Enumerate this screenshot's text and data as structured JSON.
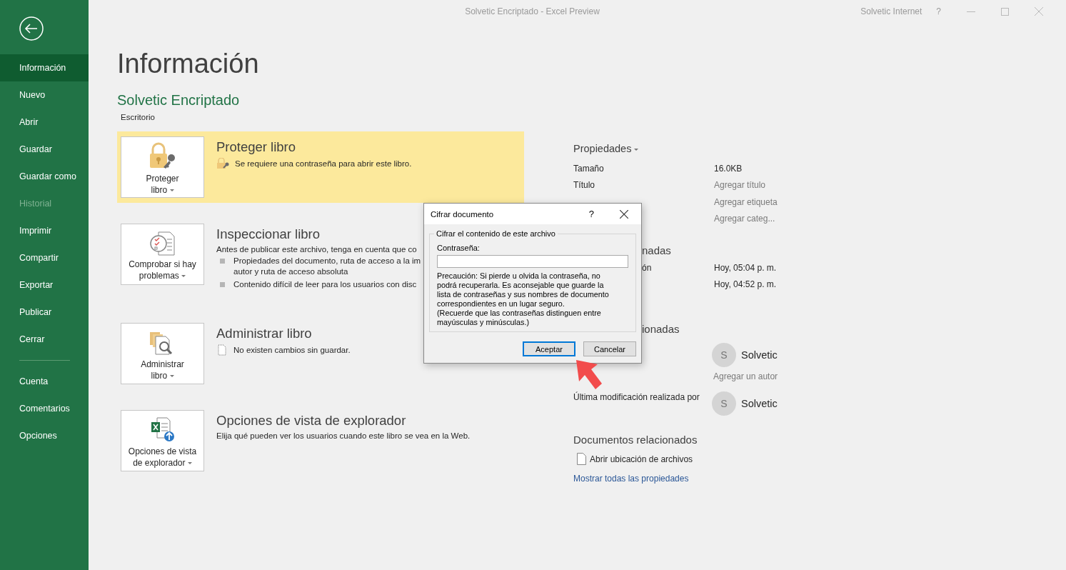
{
  "window": {
    "title": "Solvetic Encriptado  -  Excel Preview",
    "account": "Solvetic Internet",
    "help": "?"
  },
  "sidebar": {
    "items": [
      {
        "label": "Información",
        "selected": true,
        "disabled": false
      },
      {
        "label": "Nuevo",
        "selected": false,
        "disabled": false
      },
      {
        "label": "Abrir",
        "selected": false,
        "disabled": false
      },
      {
        "label": "Guardar",
        "selected": false,
        "disabled": false
      },
      {
        "label": "Guardar como",
        "selected": false,
        "disabled": false
      },
      {
        "label": "Historial",
        "selected": false,
        "disabled": true
      },
      {
        "label": "Imprimir",
        "selected": false,
        "disabled": false
      },
      {
        "label": "Compartir",
        "selected": false,
        "disabled": false
      },
      {
        "label": "Exportar",
        "selected": false,
        "disabled": false
      },
      {
        "label": "Publicar",
        "selected": false,
        "disabled": false
      },
      {
        "label": "Cerrar",
        "selected": false,
        "disabled": false
      }
    ],
    "bottom_items": [
      {
        "label": "Cuenta",
        "selected": false,
        "disabled": false
      },
      {
        "label": "Comentarios",
        "selected": false,
        "disabled": false
      },
      {
        "label": "Opciones",
        "selected": false,
        "disabled": false
      }
    ]
  },
  "page": {
    "title": "Información",
    "file_name": "Solvetic Encriptado",
    "location": "Escritorio"
  },
  "sections": [
    {
      "kind": "protect",
      "button": [
        "Proteger",
        "libro"
      ],
      "title": "Proteger libro",
      "highlighted": true,
      "status": {
        "kind": "lock",
        "text": "Se requiere una contraseña para abrir este libro."
      }
    },
    {
      "kind": "inspect",
      "button": [
        "Comprobar si hay",
        "problemas"
      ],
      "title": "Inspeccionar libro",
      "highlighted": false,
      "text": "Antes de publicar este archivo, tenga en cuenta que co",
      "bullets": [
        [
          "Propiedades del documento, ruta de acceso a la im",
          "autor y ruta de acceso absoluta"
        ],
        [
          "Contenido difícil de leer para los usuarios con disc"
        ]
      ]
    },
    {
      "kind": "manage",
      "button": [
        "Administrar",
        "libro"
      ],
      "title": "Administrar libro",
      "highlighted": false,
      "status": {
        "kind": "doc",
        "text": "No existen cambios sin guardar."
      }
    },
    {
      "kind": "browser",
      "button": [
        "Opciones de vista",
        "de explorador"
      ],
      "title": "Opciones de vista de explorador",
      "highlighted": false,
      "text": "Elija qué pueden ver los usuarios cuando este libro se vea en la Web."
    }
  ],
  "properties": {
    "title": "Propiedades",
    "rows": [
      {
        "label": "Tamaño",
        "value": "16.0KB",
        "placeholder": false
      },
      {
        "label": "Título",
        "value": "Agregar título",
        "placeholder": true
      },
      {
        "value": "Agregar etiqueta",
        "placeholder": true
      },
      {
        "value": "Agregar categ...",
        "placeholder": true
      }
    ]
  },
  "dates": {
    "title": "nadas",
    "rows": [
      {
        "label": "ón",
        "value": "Hoy, 05:04 p. m."
      },
      {
        "value": "Hoy, 04:52 p. m."
      }
    ]
  },
  "people": {
    "title": "ionadas",
    "author": {
      "initial": "S",
      "name": "Solvetic"
    },
    "add_author": "Agregar un autor",
    "modified_label": "Última modificación realizada por",
    "modified_by": {
      "initial": "S",
      "name": "Solvetic"
    }
  },
  "related": {
    "title": "Documentos relacionados",
    "open_location": "Abrir ubicación de archivos",
    "show_all": "Mostrar todas las propiedades"
  },
  "dialog": {
    "title": "Cifrar documento",
    "help": "?",
    "group": "Cifrar el contenido de este archivo",
    "field_label": "Contraseña:",
    "warning": [
      "Precaución: Si pierde u olvida la contraseña, no",
      "podrá recuperarla. Es aconsejable que guarde la",
      "lista de contraseñas y sus nombres de documento",
      "correspondientes en un lugar seguro.",
      "(Recuerde que las contraseñas distinguen entre",
      "mayúsculas y minúsculas.)"
    ],
    "buttons": [
      {
        "label": "Aceptar",
        "default": true
      },
      {
        "label": "Cancelar",
        "default": false
      }
    ]
  }
}
